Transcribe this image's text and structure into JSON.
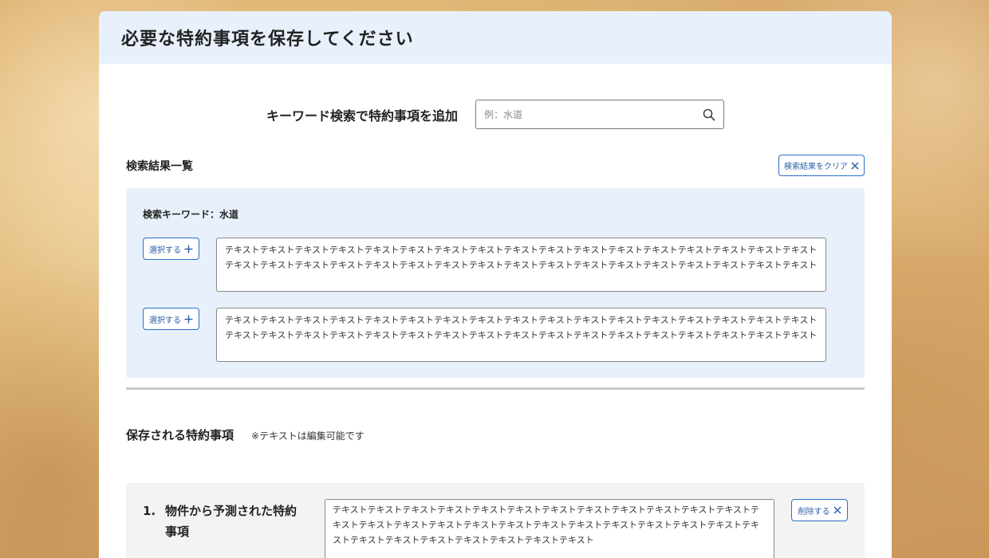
{
  "page": {
    "title": "必要な特約事項を保存してください"
  },
  "search": {
    "label": "キーワード検索で特約事項を追加",
    "placeholder": "例：水道",
    "icon": "search-icon"
  },
  "results": {
    "title": "検索結果一覧",
    "clear_label": "検索結果をクリア",
    "keyword_text": "検索キーワード：水道",
    "items": [
      {
        "select_label": "選択する",
        "text": "テキストテキストテキストテキストテキストテキストテキストテキストテキストテキストテキストテキストテキストテキストテキストテキストテキストテキストテキストテキストテキストテキストテキストテキストテキストテキストテキストテキストテキストテキストテキストテキストテキストテキスト"
      },
      {
        "select_label": "選択する",
        "text": "テキストテキストテキストテキストテキストテキストテキストテキストテキストテキストテキストテキストテキストテキストテキストテキストテキストテキストテキストテキストテキストテキストテキストテキストテキストテキストテキストテキストテキストテキストテキストテキストテキストテキスト"
      }
    ]
  },
  "saved": {
    "title": "保存される特約事項",
    "note": "※テキストは編集可能です",
    "items": [
      {
        "number": "1.",
        "label": "物件から予測された特約事項",
        "delete_label": "削除する",
        "text": "テキストテキストテキストテキストテキストテキストテキストテキストテキストテキストテキストテキストテキストテキストテキストテキストテキストテキストテキストテキストテキストテキストテキストテキストテキストテキストテキストテキストテキストテキストテキストテキスト"
      }
    ]
  },
  "colors": {
    "header_bg": "#e8f0fc",
    "results_bg": "#e8f0fc",
    "accent": "#2a6fc9"
  }
}
